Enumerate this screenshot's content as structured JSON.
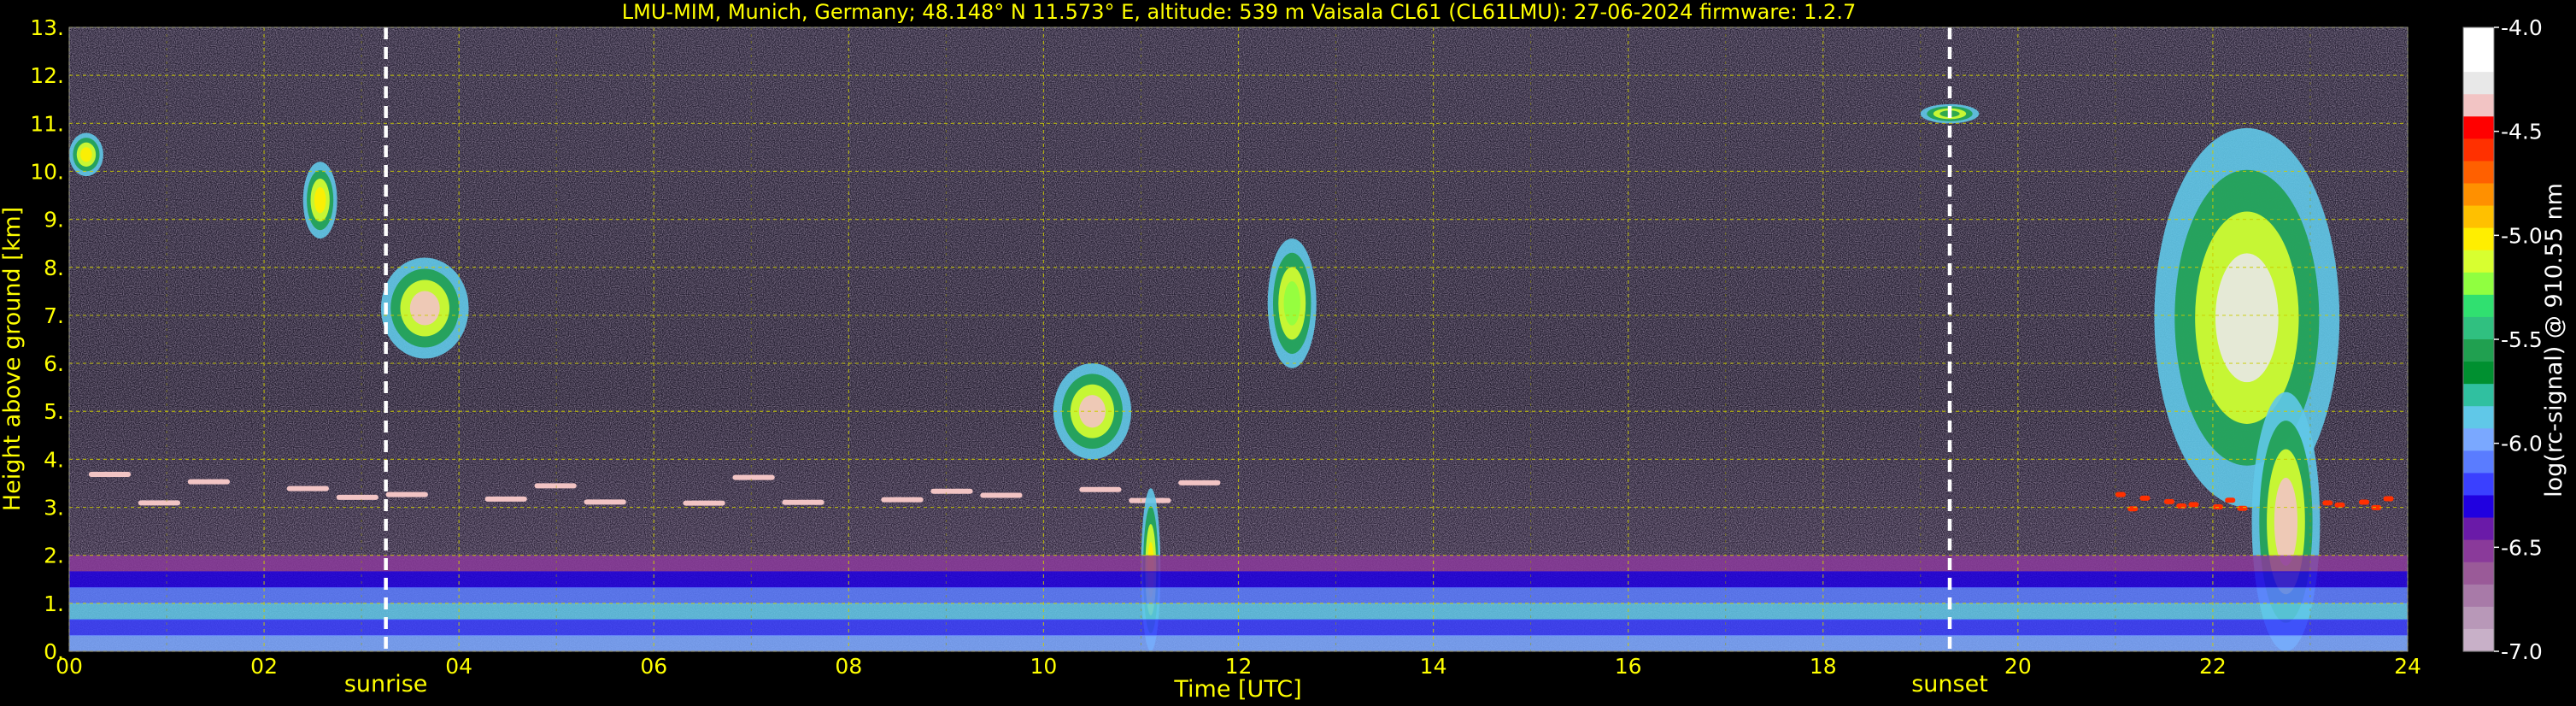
{
  "chart_data": {
    "type": "heatmap",
    "title": "LMU-MIM, Munich, Germany; 48.148° N 11.573° E, altitude: 539 m    Vaisala CL61 (CL61LMU): 27-06-2024    firmware: 1.2.7",
    "xlabel": "Time [UTC]",
    "ylabel": "Height above ground [km]",
    "xlim": [
      0,
      24
    ],
    "ylim": [
      0,
      13
    ],
    "x_ticks": [
      "00",
      "02",
      "04",
      "06",
      "08",
      "10",
      "12",
      "14",
      "16",
      "18",
      "20",
      "22",
      "24"
    ],
    "y_ticks": [
      "0.",
      "1.",
      "2.",
      "3.",
      "4.",
      "5.",
      "6.",
      "7.",
      "8.",
      "9.",
      "10.",
      "11.",
      "12.",
      "13."
    ],
    "grid": true,
    "markers": [
      {
        "label": "sunrise",
        "time": 3.25
      },
      {
        "label": "sunset",
        "time": 19.3
      }
    ],
    "colorbar": {
      "label": "log(rc-signal) @ 910.55 nm",
      "range": [
        -7.0,
        -4.0
      ],
      "ticks": [
        "-4.0",
        "-4.5",
        "-5.0",
        "-5.5",
        "-6.0",
        "-6.5",
        "-7.0"
      ],
      "colors": [
        "#ffffff",
        "#ffffff",
        "#e8e8e8",
        "#f2c4c4",
        "#ff0000",
        "#ff3000",
        "#ff6000",
        "#ff9000",
        "#ffc000",
        "#ffee00",
        "#d8ff30",
        "#90ff40",
        "#30e070",
        "#30c080",
        "#20a050",
        "#009030",
        "#30c0a0",
        "#60c8e8",
        "#7aa8ff",
        "#5a7cff",
        "#3a40ff",
        "#2000e0",
        "#6a1aa8",
        "#8a3a9a",
        "#9a5a98",
        "#a87aa8",
        "#b898b8",
        "#c8b0c8"
      ],
      "position": "right"
    },
    "features": [
      {
        "type": "cloud",
        "t_start": 0.0,
        "t_end": 0.35,
        "h_bottom": 9.9,
        "h_top": 10.8,
        "peak_log_signal": -5.0
      },
      {
        "type": "cloud",
        "t_start": 2.4,
        "t_end": 2.75,
        "h_bottom": 8.6,
        "h_top": 10.2,
        "peak_log_signal": -5.0
      },
      {
        "type": "cloud",
        "t_start": 3.2,
        "t_end": 4.1,
        "h_bottom": 6.1,
        "h_top": 8.2,
        "peak_log_signal": -4.3
      },
      {
        "type": "cloud",
        "t_start": 10.1,
        "t_end": 10.9,
        "h_bottom": 4.0,
        "h_top": 6.0,
        "peak_log_signal": -4.3
      },
      {
        "type": "cloud",
        "t_start": 12.3,
        "t_end": 12.8,
        "h_bottom": 5.9,
        "h_top": 8.6,
        "peak_log_signal": -5.2
      },
      {
        "type": "cloud",
        "t_start": 19.0,
        "t_end": 19.6,
        "h_bottom": 11.0,
        "h_top": 11.4,
        "peak_log_signal": -5.5
      },
      {
        "type": "cloud",
        "t_start": 21.4,
        "t_end": 23.3,
        "h_bottom": 3.0,
        "h_top": 10.9,
        "peak_log_signal": -4.2
      },
      {
        "type": "thin_layer",
        "t_start": 0.2,
        "t_end": 12.4,
        "h_bottom": 2.9,
        "h_top": 4.1,
        "peak_log_signal": -4.3
      },
      {
        "type": "thin_layer",
        "t_start": 21.0,
        "t_end": 24.0,
        "h_bottom": 2.9,
        "h_top": 3.5,
        "peak_log_signal": -4.5
      },
      {
        "type": "precipitation",
        "t_start": 11.0,
        "t_end": 11.2,
        "h_bottom": 0.0,
        "h_top": 3.4,
        "peak_log_signal": -5.0
      },
      {
        "type": "precipitation",
        "t_start": 22.4,
        "t_end": 23.1,
        "h_bottom": 0.0,
        "h_top": 5.4,
        "peak_log_signal": -4.3
      },
      {
        "type": "boundary_layer",
        "t_start": 0.0,
        "t_end": 24.0,
        "h_bottom": 0.0,
        "h_top": 2.0,
        "peak_log_signal": -5.8
      }
    ]
  }
}
